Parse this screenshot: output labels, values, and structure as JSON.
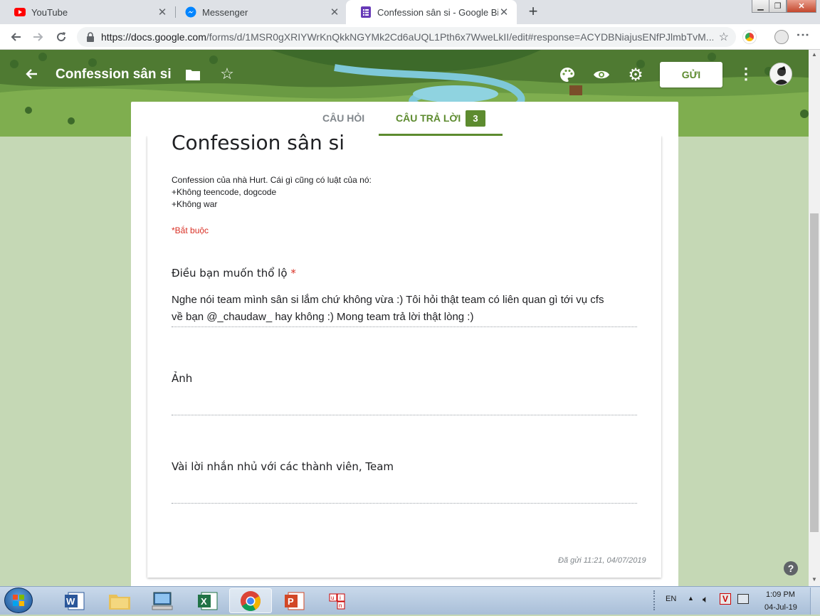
{
  "browser": {
    "tabs": [
      {
        "title": "YouTube",
        "icon": "youtube-icon"
      },
      {
        "title": "Messenger",
        "icon": "messenger-icon"
      },
      {
        "title": "Confession sân si - Google Biểu m",
        "icon": "google-forms-icon",
        "active": true
      }
    ],
    "url_host": "https://docs.google.com",
    "url_path": "/forms/d/1MSR0gXRIYWrKnQkkNGYMk2Cd6aUQL1Pth6x7WweLkII/edit#response=ACYDBNiajusENfPJlmbTvM..."
  },
  "header": {
    "form_name": "Confession sân si",
    "send_label": "GỬI"
  },
  "tabs": {
    "questions_label": "CÂU HỎI",
    "responses_label": "CÂU TRẢ LỜI",
    "response_count": "3"
  },
  "form": {
    "title": "Confession sân si",
    "description_lines": [
      "Confession của nhà Hurt. Cái gì cũng có luật của nó:",
      "+Không teencode, dogcode",
      "+Không war"
    ],
    "required_note": "*Bắt buộc",
    "questions": [
      {
        "title": "Điều bạn muốn thổ lộ",
        "required_mark": "*",
        "answer_lines": [
          "Nghe nói team mình sân si lắm chứ không vừa :) Tôi hỏi thật team có liên quan gì tới vụ cfs",
          "về bạn @_chaudaw_ hay không :) Mong team trả lời thật lòng :)"
        ]
      },
      {
        "title": "Ảnh",
        "answer_lines": []
      },
      {
        "title": "Vài lời nhắn nhủ với các thành viên, Team",
        "answer_lines": []
      }
    ],
    "submitted_text": "Đã gửi 11:21, 04/07/2019"
  },
  "taskbar": {
    "apps": [
      "word-icon",
      "file-explorer-icon",
      "computer-icon",
      "excel-icon",
      "chrome-icon",
      "powerpoint-icon",
      "unikey-icon"
    ],
    "language": "EN",
    "time": "1:09 PM",
    "date": "04-Jul-19"
  },
  "colors": {
    "accent": "#5d8b2f",
    "required": "#d93025",
    "background": "#c5d8b5"
  }
}
